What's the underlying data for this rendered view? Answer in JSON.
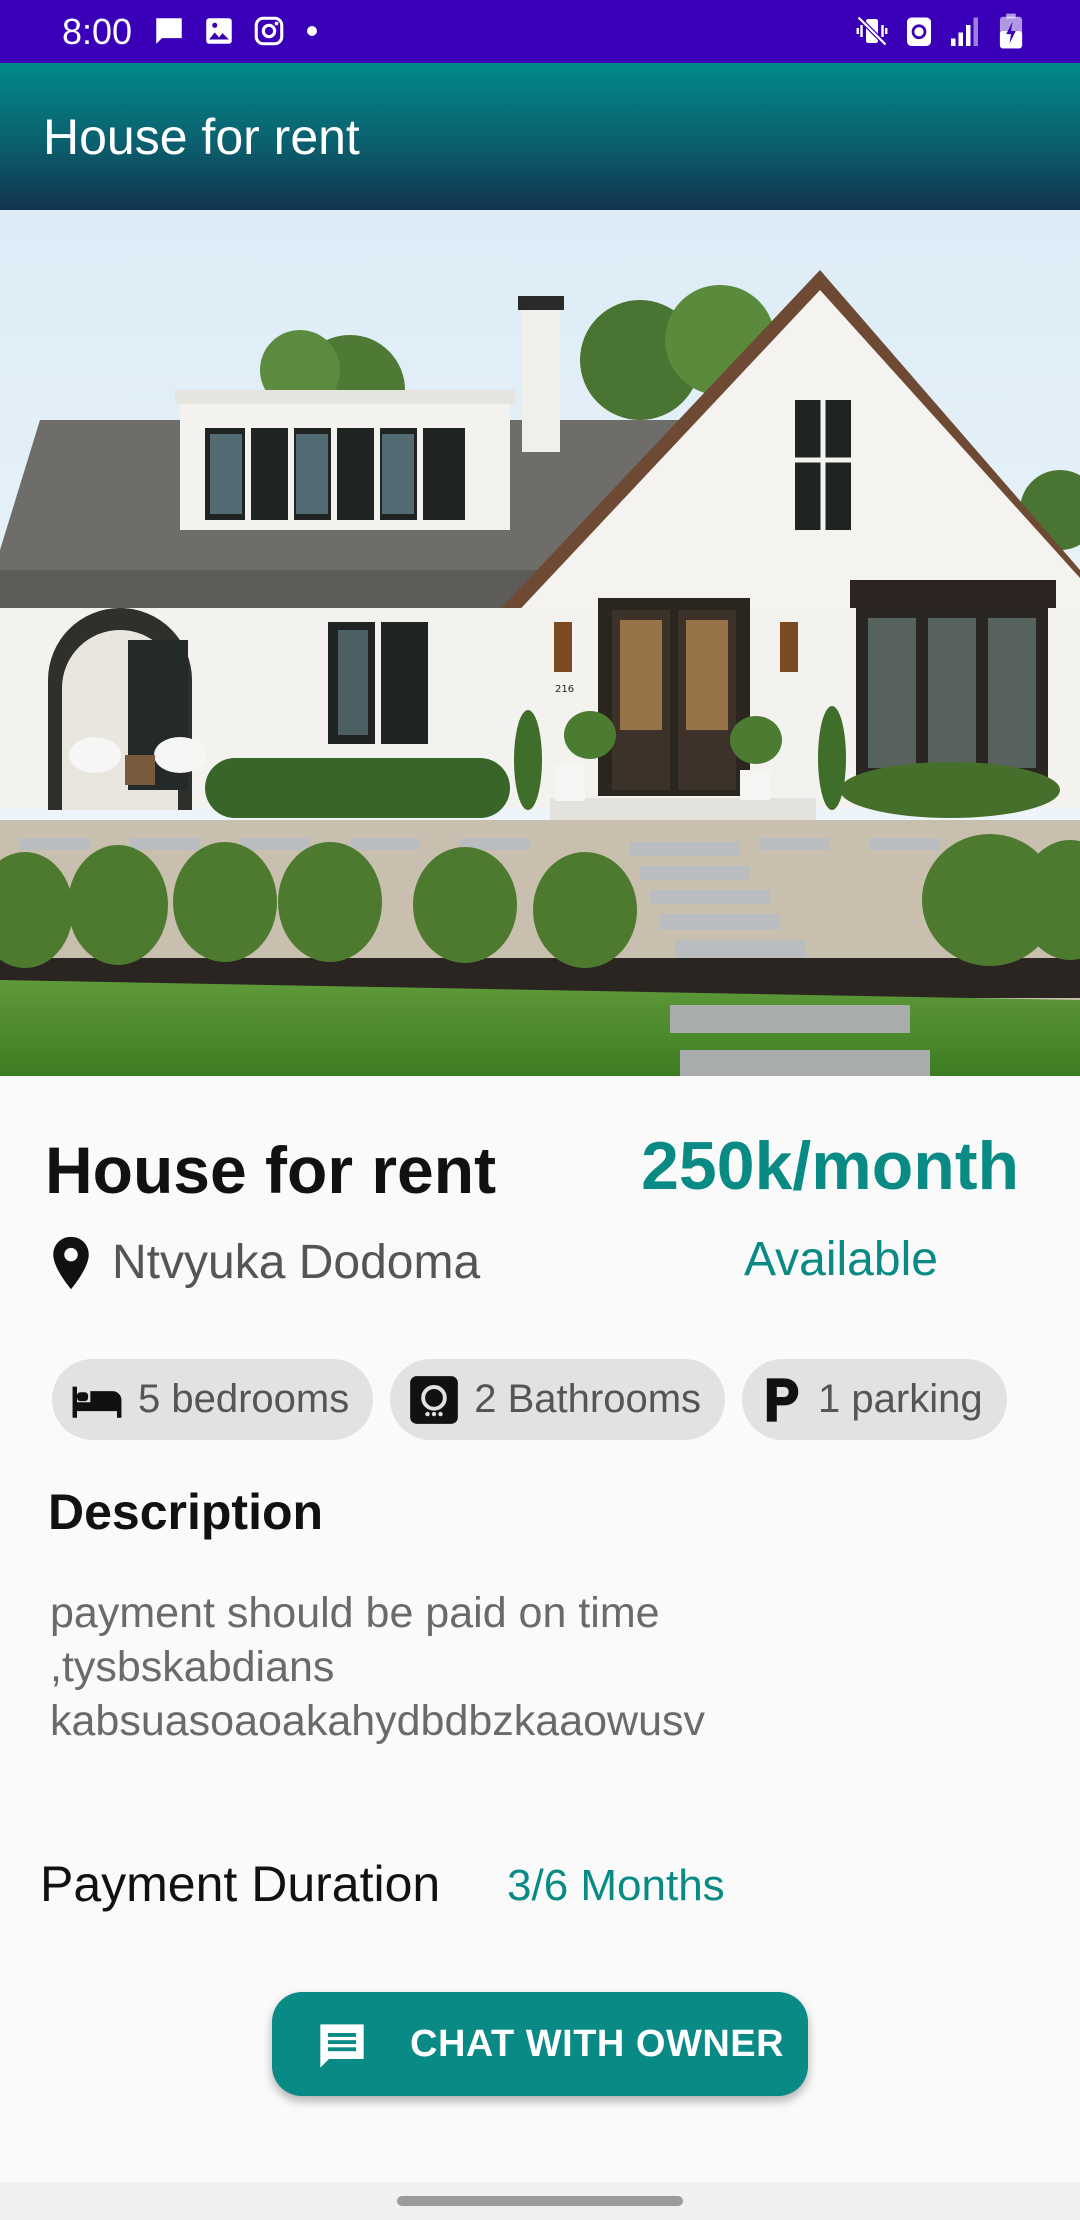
{
  "status_bar": {
    "time": "8:00",
    "left_icons": [
      "message-icon",
      "image-icon",
      "instagram-icon",
      "dot-icon"
    ],
    "right_icons": [
      "vibrate-mute-icon",
      "recycle-icon",
      "signal-icon",
      "battery-charging-icon"
    ],
    "color": "#3a00b8"
  },
  "app_bar": {
    "title": "House for rent"
  },
  "hero": {
    "house_number": "216"
  },
  "listing": {
    "title": "House for rent",
    "price": "250k/month",
    "location": "Ntvyuka Dodoma",
    "availability": "Available"
  },
  "features": [
    {
      "icon": "bed-icon",
      "label": "5 bedrooms"
    },
    {
      "icon": "bathroom-icon",
      "label": "2 Bathrooms"
    },
    {
      "icon": "parking-icon",
      "label": "1 parking"
    }
  ],
  "description": {
    "heading": "Description",
    "text": "payment should be paid on time\n,tysbskabdians\nkabsuasoaoakahydbdbzkaaowusv"
  },
  "payment": {
    "label": "Payment Duration",
    "value": "3/6 Months"
  },
  "chat_button": {
    "label": "CHAT WITH OWNER",
    "icon": "message-icon"
  },
  "colors": {
    "accent": "#0a8a84",
    "status_bar": "#3a00b8",
    "background": "#fafafa"
  }
}
